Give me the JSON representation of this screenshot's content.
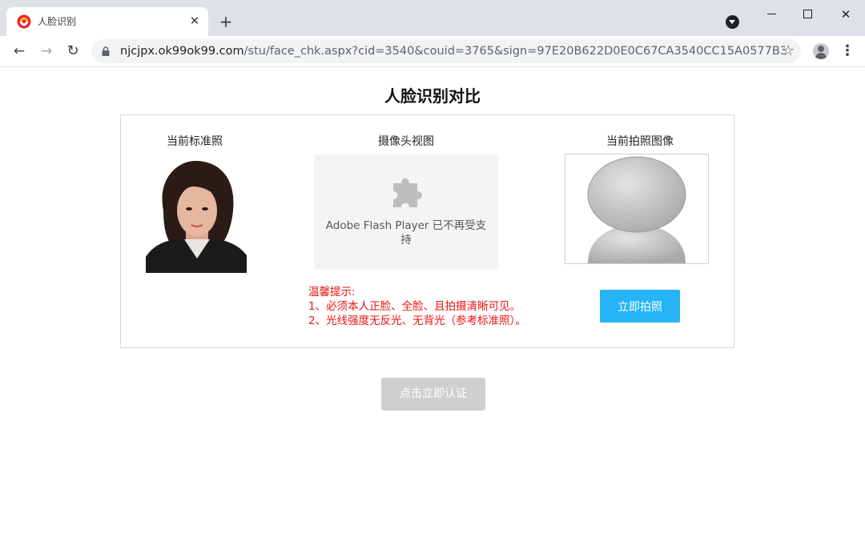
{
  "browser": {
    "tab_title": "人脸识别",
    "tab_close_glyph": "✕",
    "new_tab_glyph": "+",
    "url_host": "njcjpx.ok99ok99.com",
    "url_path": "/stu/face_chk.aspx?cid=3540&couid=3765&sign=97E20B622D0E0C67CA3540CC15A0577B37...",
    "close_glyph": "✕",
    "back_glyph": "←",
    "forward_glyph": "→",
    "reload_glyph": "↻",
    "star_glyph": "☆",
    "menu_glyph": "⋮"
  },
  "page": {
    "title": "人脸识别对比",
    "standard_photo_label": "当前标准照",
    "camera_label": "摄像头视图",
    "snapshot_label": "当前拍照图像",
    "flash_message": "Adobe Flash Player 已不再受支持",
    "tips": {
      "heading": "温馨提示:",
      "line1": "1、必须本人正脸、全脸、且拍摄清晰可见。",
      "line2": "2、光线强度无反光、无背光（参考标准照）。"
    },
    "shoot_button": "立即拍照",
    "verify_button": "点击立即认证"
  },
  "colors": {
    "accent_button": "#25b4f5",
    "disabled_button": "#cfcfcf",
    "tips_text": "#ee1111"
  }
}
